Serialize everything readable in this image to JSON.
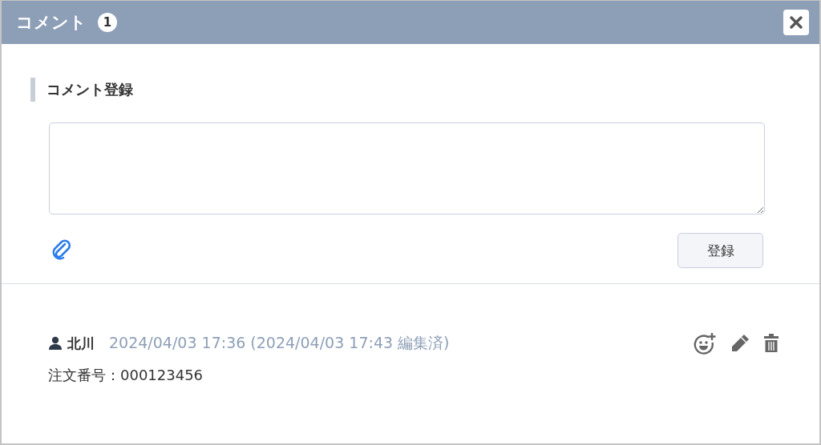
{
  "header": {
    "title": "コメント",
    "count": "1"
  },
  "form": {
    "section_title": "コメント登録",
    "submit_label": "登録"
  },
  "comments": [
    {
      "author": "北川",
      "timestamp": "2024/04/03 17:36 (2024/04/03 17:43 編集済)",
      "body": "注文番号：000123456"
    }
  ]
}
